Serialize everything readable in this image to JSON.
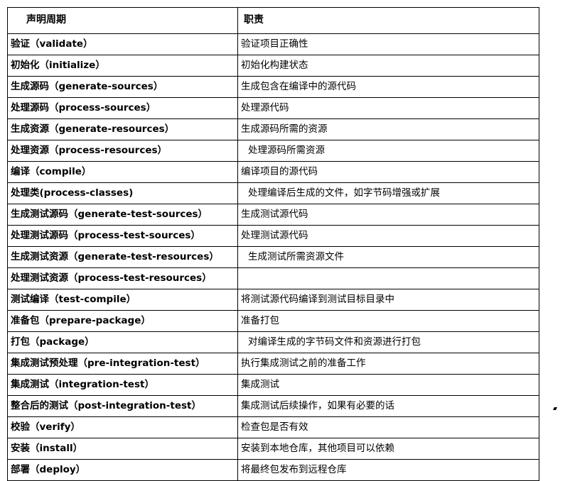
{
  "document": {
    "title": "Maven 生命周期表",
    "background_color": "#ffffff",
    "border_color": "#000000",
    "text_color": "#000000"
  },
  "table": {
    "headers": {
      "phase": "声明周期",
      "responsibility": "职责"
    },
    "rows": [
      {
        "phase": "验证（validate）",
        "desc": "验证项目正确性",
        "indented": false
      },
      {
        "phase": "初始化（initialize）",
        "desc": "初始化构建状态",
        "indented": false
      },
      {
        "phase": "生成源码（generate-sources）",
        "desc": "生成包含在编译中的源代码",
        "indented": false
      },
      {
        "phase": "处理源码（process-sources）",
        "desc": "处理源代码",
        "indented": false
      },
      {
        "phase": "生成资源（generate-resources）",
        "desc": "生成源码所需的资源",
        "indented": false
      },
      {
        "phase": "处理资源（process-resources）",
        "desc": "处理源码所需资源",
        "indented": true
      },
      {
        "phase": "编译（compile）",
        "desc": "编译项目的源代码",
        "indented": false
      },
      {
        "phase": "处理类(process-classes)",
        "desc": "处理编译后生成的文件，如字节码增强或扩展",
        "indented": true
      },
      {
        "phase": "生成测试源码（generate-test-sources）",
        "desc": "生成测试源代码",
        "indented": false
      },
      {
        "phase": "处理测试源码（process-test-sources）",
        "desc": "处理测试源代码",
        "indented": false
      },
      {
        "phase": "生成测试资源（generate-test-resources）",
        "desc": "生成测试所需资源文件",
        "indented": true
      },
      {
        "phase": "处理测试资源（process-test-resources）",
        "desc": "",
        "indented": false
      },
      {
        "phase": "测试编译（test-compile）",
        "desc": "将测试源代码编译到测试目标目录中",
        "indented": false
      },
      {
        "phase": "准备包（prepare-package）",
        "desc": "准备打包",
        "indented": false
      },
      {
        "phase": "打包（package）",
        "desc": "对编译生成的字节码文件和资源进行打包",
        "indented": true
      },
      {
        "phase": "集成测试预处理（pre-integration-test）",
        "desc": "执行集成测试之前的准备工作",
        "indented": false
      },
      {
        "phase": "集成测试（integration-test）",
        "desc": "集成测试",
        "indented": false
      },
      {
        "phase": "整合后的测试（post-integration-test）",
        "desc": "集成测试后续操作，如果有必要的话",
        "indented": false
      },
      {
        "phase": "校验（verify）",
        "desc": "检查包是否有效",
        "indented": false
      },
      {
        "phase": "安装（install）",
        "desc": "安装到本地仓库，其他项目可以依赖",
        "indented": false
      },
      {
        "phase": "部署（deploy）",
        "desc": "将最终包发布到远程仓库",
        "indented": false
      }
    ]
  }
}
